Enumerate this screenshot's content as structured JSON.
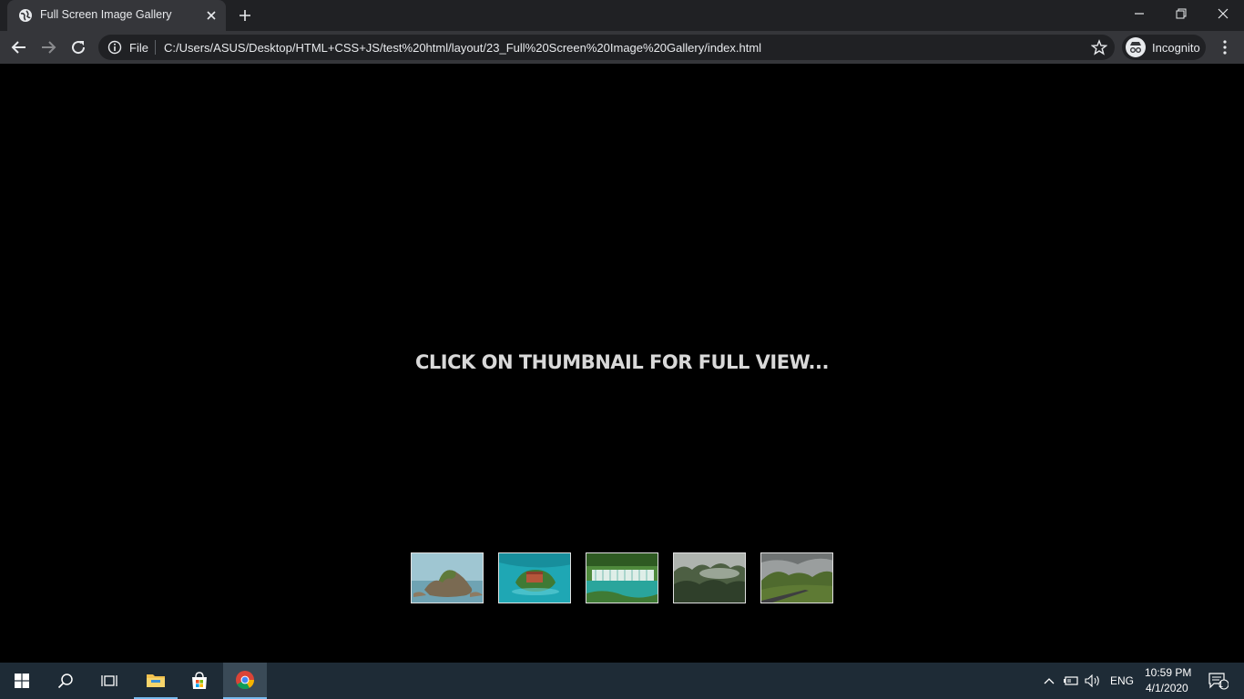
{
  "browser": {
    "tab_title": "Full Screen Image Gallery",
    "scheme_label": "File",
    "url": "C:/Users/ASUS/Desktop/HTML+CSS+JS/test%20html/layout/23_Full%20Screen%20Image%20Gallery/index.html",
    "profile_label": "Incognito"
  },
  "page": {
    "hint": "CLICK ON THUMBNAIL FOR FULL VIEW..."
  },
  "thumbnails": [
    {
      "name": "thumbnail-rocky-island",
      "icon": "image-icon"
    },
    {
      "name": "thumbnail-turquoise-island",
      "icon": "image-icon"
    },
    {
      "name": "thumbnail-waterfalls",
      "icon": "image-icon"
    },
    {
      "name": "thumbnail-misty-forest",
      "icon": "image-icon"
    },
    {
      "name": "thumbnail-mountain-road",
      "icon": "image-icon"
    }
  ],
  "taskbar": {
    "language": "ENG",
    "time": "10:59 PM",
    "date": "4/1/2020",
    "notification_count": "1"
  },
  "colors": {
    "chrome_dark": "#202124",
    "chrome_toolbar": "#35363a",
    "page_bg": "#000000",
    "hint_text": "#d9d9d9",
    "taskbar_bg": "#1e2b36"
  }
}
